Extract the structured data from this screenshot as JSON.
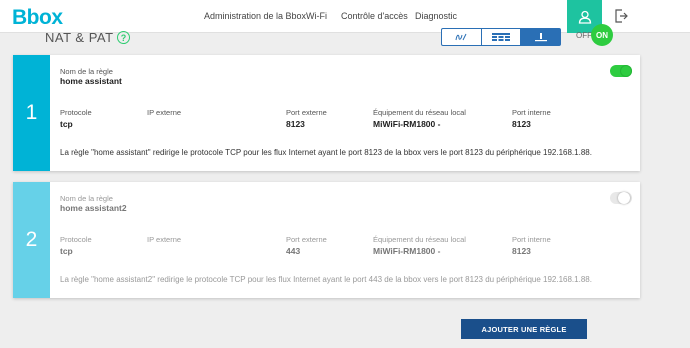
{
  "header": {
    "logo": "Bbox",
    "nav": [
      "Administration de la Bbox",
      "Wi-Fi",
      "Contrôle d'accès",
      "Diagnostic"
    ]
  },
  "page": {
    "title": "NAT & PAT",
    "help": "?",
    "off_label": "OFF",
    "on_label": "ON"
  },
  "labels": {
    "name": "Nom de la règle",
    "protocol": "Protocole",
    "external_ip": "IP externe",
    "external_port": "Port externe",
    "local_device": "Équipement du réseau local",
    "internal_port": "Port interne"
  },
  "rules": [
    {
      "number": "1",
      "name": "home assistant",
      "protocol": "tcp",
      "external_ip": "",
      "external_port": "8123",
      "local_device": "MiWiFi-RM1800 -",
      "internal_port": "8123",
      "enabled": true,
      "description": "La règle \"home assistant\" redirige le protocole TCP pour les flux Internet ayant le port 8123 de la bbox vers le port 8123 du périphérique 192.168.1.88."
    },
    {
      "number": "2",
      "name": "home assistant2",
      "protocol": "tcp",
      "external_ip": "",
      "external_port": "443",
      "local_device": "MiWiFi-RM1800 -",
      "internal_port": "8123",
      "enabled": false,
      "description": "La règle \"home assistant2\" redirige le protocole TCP pour les flux Internet ayant le port 443 de la bbox vers le port 8123 du périphérique 192.168.1.88."
    }
  ],
  "add_button": "AJOUTER UNE RÈGLE",
  "colors": {
    "brand": "#00b3d6",
    "accent_green": "#2ecc40",
    "user_button": "#1ec3a0",
    "primary_button": "#1a4f8b"
  }
}
